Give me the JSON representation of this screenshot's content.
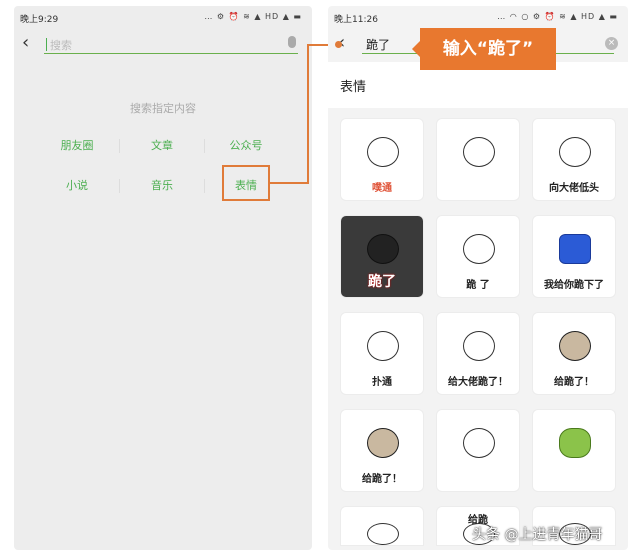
{
  "left": {
    "time": "晚上9:29",
    "status_icons": "… ⚙ ⏰ ≋ ▲ HD ▲ ▬",
    "search_placeholder": "搜索",
    "hint": "搜索指定内容",
    "categories": [
      "朋友圈",
      "文章",
      "公众号",
      "小说",
      "音乐",
      "表情"
    ]
  },
  "right": {
    "time": "晚上11:26",
    "status_icons": "… ◠ ○ ⚙ ⏰ ≋ ▲ HD ▲ ▬",
    "search_value": "跪了",
    "section": "表情",
    "stickers": [
      {
        "caption": "噗通",
        "style": "plain"
      },
      {
        "caption": "",
        "style": "plain"
      },
      {
        "caption": "向大佬低头",
        "style": "plain"
      },
      {
        "caption": "跪了",
        "style": "photo"
      },
      {
        "caption": "跪 了",
        "style": "plain"
      },
      {
        "caption": "我给你跪下了",
        "style": "blue"
      },
      {
        "caption": "扑通",
        "style": "plain"
      },
      {
        "caption": "给大佬跪了！",
        "style": "plain"
      },
      {
        "caption": "给跪了！",
        "style": "bear"
      },
      {
        "caption": "给跪了！",
        "style": "bear"
      },
      {
        "caption": "",
        "style": "plain"
      },
      {
        "caption": "",
        "style": "green"
      },
      {
        "caption": "",
        "style": "plain"
      },
      {
        "caption": "给跪",
        "style": "plain"
      },
      {
        "caption": "",
        "style": "plain"
      }
    ]
  },
  "callout": "输入“跪了”",
  "watermark": "头条 @上进青年猫哥",
  "colors": {
    "accent": "#e8782f",
    "green": "#4caf50"
  }
}
